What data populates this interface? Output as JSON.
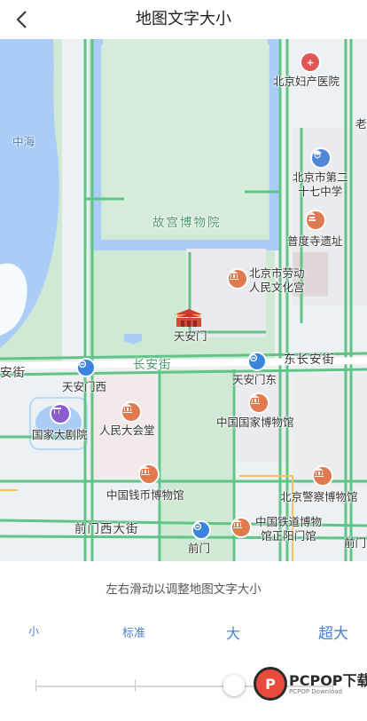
{
  "header": {
    "title": "地图文字大小"
  },
  "map": {
    "labels": {
      "zhonghai": "中海",
      "palace": "故宫博物院",
      "beijing_fuchan": "北京妇产医院",
      "school_l1": "北京市第二",
      "school_l2": "十七中学",
      "pudu_temple": "普度寺遗址",
      "culture_l1": "北京市劳动",
      "culture_l2": "人民文化宫",
      "tiananmen": "天安门",
      "changan_street": "长安街",
      "an_street": "安街",
      "east_changan": "东长安街",
      "tiananmen_west": "天安门西",
      "tiananmen_east": "天安门东",
      "national_theatre": "国家大剧院",
      "great_hall": "人民大会堂",
      "national_museum": "中国国家博物馆",
      "numismatic_museum": "中国钱币博物馆",
      "police_museum": "北京警察博物馆",
      "railway_l1": "中国铁道博物",
      "railway_l2": "馆正阳门馆",
      "qianmen_west": "前门西大街",
      "qianmen": "前门",
      "qianmen_right": "前门",
      "lao": "老"
    }
  },
  "font_size_panel": {
    "hint": "左右滑动以调整地图文字大小",
    "options": [
      "小",
      "标准",
      "大",
      "超大"
    ],
    "selected": "大",
    "selected_index": 2
  },
  "watermark": {
    "brand": "PCPOP下载",
    "sub": "PCPOP Download"
  },
  "colors": {
    "accent": "#4a7fd0",
    "road_green": "#58c27d",
    "water": "#a9cdf6",
    "park": "#c9e7cf"
  }
}
